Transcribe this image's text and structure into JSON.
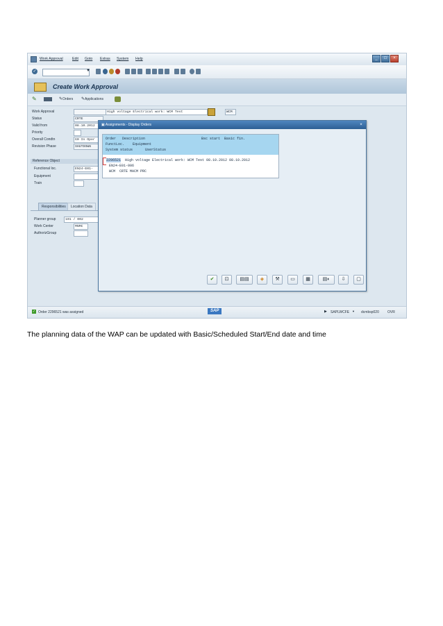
{
  "menubar": {
    "items": [
      "Work Approval",
      "Edit",
      "Goto",
      "Extras",
      "System",
      "Help"
    ]
  },
  "title": "Create Work Approval",
  "app_toolbar": {
    "orders_label": "Orders",
    "applications_label": "Applications"
  },
  "header_fields": [
    {
      "label": "Work Approval",
      "value": ""
    },
    {
      "label": "Status",
      "value": "CRTE"
    },
    {
      "label": "Valid from",
      "value": "08.10.2012"
    },
    {
      "label": "Priority",
      "value": ""
    },
    {
      "label": "Overall Condtn",
      "value": "G0  In Oper"
    },
    {
      "label": "Revision Phase",
      "value": "SHUTDOWN"
    }
  ],
  "description": {
    "value": "High voltage Electrical work: WCM Test",
    "code": "WCM"
  },
  "reference_object": {
    "title": "Reference Object",
    "fields": [
      {
        "label": "Functional loc.",
        "value": "EN24-E01-"
      },
      {
        "label": "Equipment",
        "value": ""
      },
      {
        "label": "Train",
        "value": ""
      }
    ]
  },
  "tabs": [
    "Responsibilities",
    "Location Data"
  ],
  "responsibility_fields": [
    {
      "label": "Planner group",
      "value": "101 / 002"
    },
    {
      "label": "Work Center",
      "value": "MNMC"
    },
    {
      "label": "AuthorizGroup",
      "value": ""
    }
  ],
  "dialog": {
    "title": "Assignments - Display Orders",
    "header_line1": "Order   Description                           Bsc start  Basic fin.",
    "header_line2": "FunctLoc.    Equipment",
    "header_line3": "System status      UserStatus",
    "order_number": "2296521",
    "row_line1": " High voltage Electrical work: WCM Test 08.10.2012 08.10.2012",
    "row_line2": "EN24-E01-006",
    "row_line3": "WCM  CRTE MACM PRC"
  },
  "status": {
    "message": "Order 2296521 was assigned",
    "sap_logo": "SAP",
    "system": "SAPLWCFE",
    "server": "dcmbsp020",
    "mode": "OVR"
  },
  "caption": "The planning data of the WAP can be updated with Basic/Scheduled Start/End date and time",
  "colors": {
    "dialog_title": "#2d5f94",
    "list_header": "#a6d6f0",
    "selection": "#d23b3b"
  }
}
